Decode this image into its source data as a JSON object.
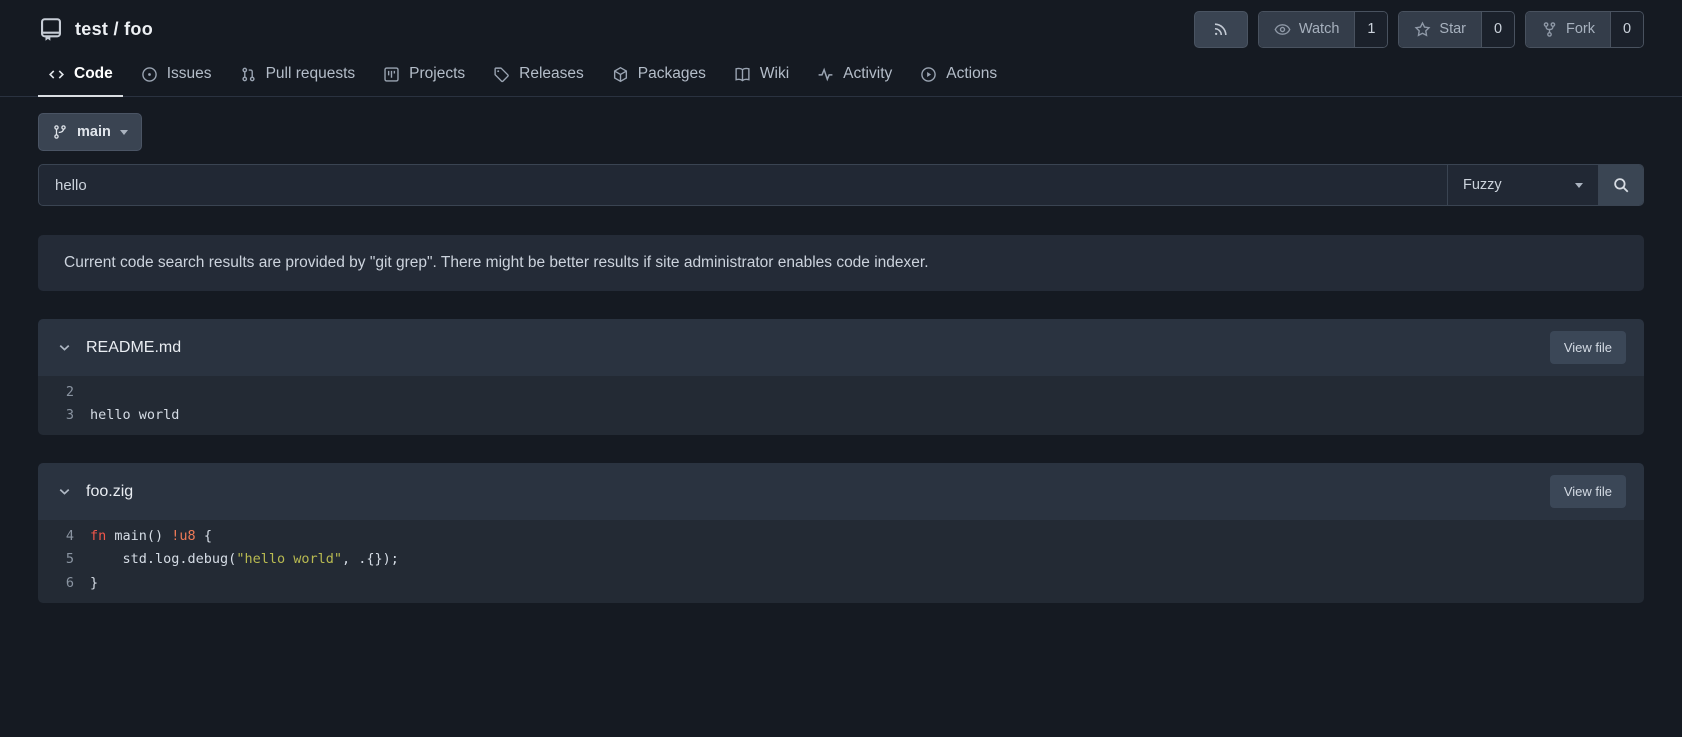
{
  "header": {
    "repo_title": "test / foo",
    "rss_icon": "rss-feed",
    "watch": {
      "label": "Watch",
      "count": "1"
    },
    "star": {
      "label": "Star",
      "count": "0"
    },
    "fork": {
      "label": "Fork",
      "count": "0"
    }
  },
  "tabs": [
    {
      "label": "Code",
      "active": true
    },
    {
      "label": "Issues"
    },
    {
      "label": "Pull requests"
    },
    {
      "label": "Projects"
    },
    {
      "label": "Releases"
    },
    {
      "label": "Packages"
    },
    {
      "label": "Wiki"
    },
    {
      "label": "Activity"
    },
    {
      "label": "Actions"
    }
  ],
  "branch_selector": {
    "label": "main"
  },
  "search": {
    "value": "hello",
    "mode": "Fuzzy"
  },
  "notice": "Current code search results are provided by \"git grep\". There might be better results if site administrator enables code indexer.",
  "results": [
    {
      "filename": "README.md",
      "view_file_label": "View file",
      "lines": [
        {
          "number": "2",
          "segments": []
        },
        {
          "number": "3",
          "segments": [
            {
              "text": "hello world",
              "style": "plain"
            }
          ]
        }
      ]
    },
    {
      "filename": "foo.zig",
      "view_file_label": "View file",
      "lines": [
        {
          "number": "4",
          "segments": [
            {
              "text": "fn",
              "style": "kw"
            },
            {
              "text": " main() ",
              "style": "plain"
            },
            {
              "text": "!u8",
              "style": "type"
            },
            {
              "text": " {",
              "style": "plain"
            }
          ]
        },
        {
          "number": "5",
          "segments": [
            {
              "text": "    std.log.debug(",
              "style": "plain"
            },
            {
              "text": "\"hello world\"",
              "style": "str"
            },
            {
              "text": ", .{});",
              "style": "plain"
            }
          ]
        },
        {
          "number": "6",
          "segments": [
            {
              "text": "}",
              "style": "plain"
            }
          ]
        }
      ]
    }
  ],
  "colors": {
    "page_bg": "#151a22",
    "panel_bg": "#242b37",
    "result_header_bg": "#2a3340",
    "code_bg": "#232a34",
    "button_bg": "#3a4553",
    "syntax_keyword": "#f0564a",
    "syntax_type": "#ee7a57",
    "syntax_string": "#b8ba51"
  }
}
